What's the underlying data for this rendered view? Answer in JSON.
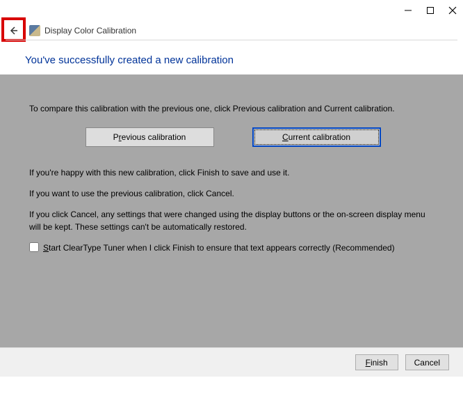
{
  "window": {
    "title": "Display Color Calibration"
  },
  "heading": "You've successfully created a new calibration",
  "content": {
    "intro": "To compare this calibration with the previous one, click Previous calibration and Current calibration.",
    "prev_btn_pre": "P",
    "prev_btn_accel": "r",
    "prev_btn_post": "evious calibration",
    "curr_btn_pre": "",
    "curr_btn_accel": "C",
    "curr_btn_post": "urrent calibration",
    "happy": "If you're happy with this new calibration, click Finish to save and use it.",
    "cancel": "If you want to use the previous calibration, click Cancel.",
    "warning": "If you click Cancel, any settings that were changed using the display buttons or the on-screen display menu will be kept. These settings can't be automatically restored.",
    "cleartype_accel": "S",
    "cleartype_post": "tart ClearType Tuner when I click Finish to ensure that text appears correctly (Recommended)"
  },
  "footer": {
    "finish_accel": "F",
    "finish_post": "inish",
    "cancel": "Cancel"
  }
}
